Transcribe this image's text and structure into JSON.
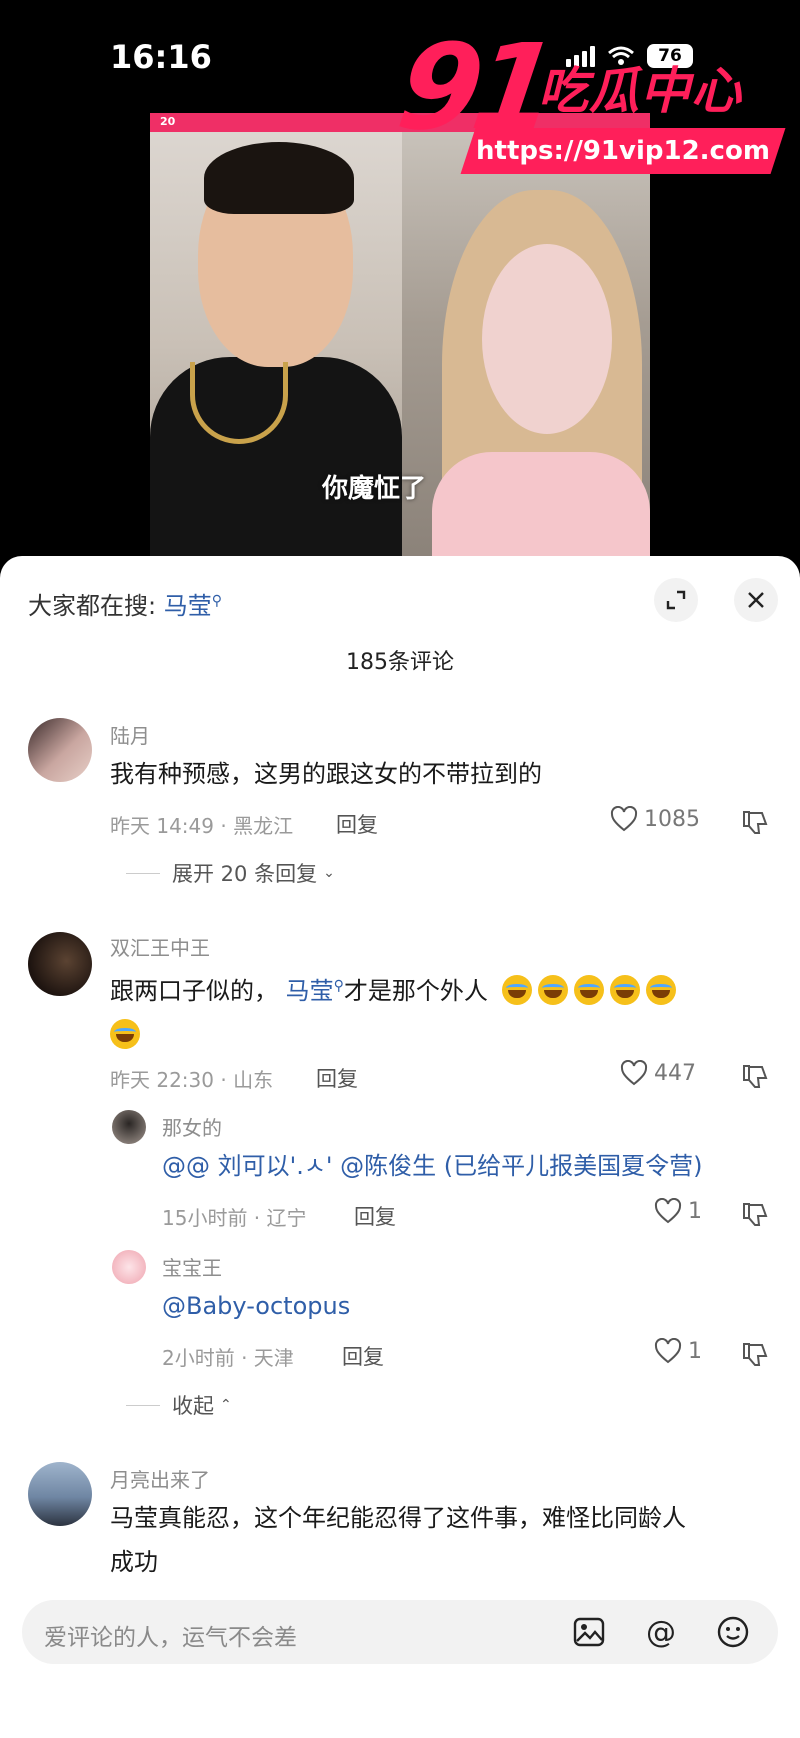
{
  "status": {
    "time": "16:16",
    "battery": "76"
  },
  "watermark": {
    "brand_number": "91",
    "brand_title": "吃瓜中心",
    "url": "https://91vip12.com"
  },
  "video": {
    "frame_badge": "20",
    "caption": "你魔怔了"
  },
  "panel": {
    "search_prefix": "大家都在搜:",
    "search_keyword": "马莹",
    "comment_count": "185条评论"
  },
  "comments": [
    {
      "user": "陆月",
      "text": "我有种预感，这男的跟这女的不带拉到的",
      "meta": "昨天 14:49 · 黑龙江",
      "reply_label": "回复",
      "likes": "1085",
      "expand": "展开 20 条回复"
    },
    {
      "user": "双汇王中王",
      "text_before": "跟两口子似的，",
      "keyword": "马莹",
      "text_after": "才是那个外人",
      "meta": "昨天 22:30 · 山东",
      "reply_label": "回复",
      "likes": "447",
      "replies": [
        {
          "user": "那女的",
          "text": "@@ 刘可以'.ㅅ' @陈俊生 (已给平儿报美国夏令营)",
          "meta": "15小时前 · 辽宁",
          "reply_label": "回复",
          "likes": "1"
        },
        {
          "user": "宝宝王",
          "text": "@Baby-octopus",
          "meta": "2小时前 · 天津",
          "reply_label": "回复",
          "likes": "1"
        }
      ],
      "collapse": "收起"
    },
    {
      "user": "月亮出来了",
      "text_line1": "马莹真能忍，这个年纪能忍得了这件事，难怪比同龄人",
      "text_line2": "成功"
    }
  ],
  "input": {
    "placeholder": "爱评论的人，运气不会差"
  },
  "colors": {
    "accent": "#ff1f5a",
    "link": "#2f5ea8"
  }
}
